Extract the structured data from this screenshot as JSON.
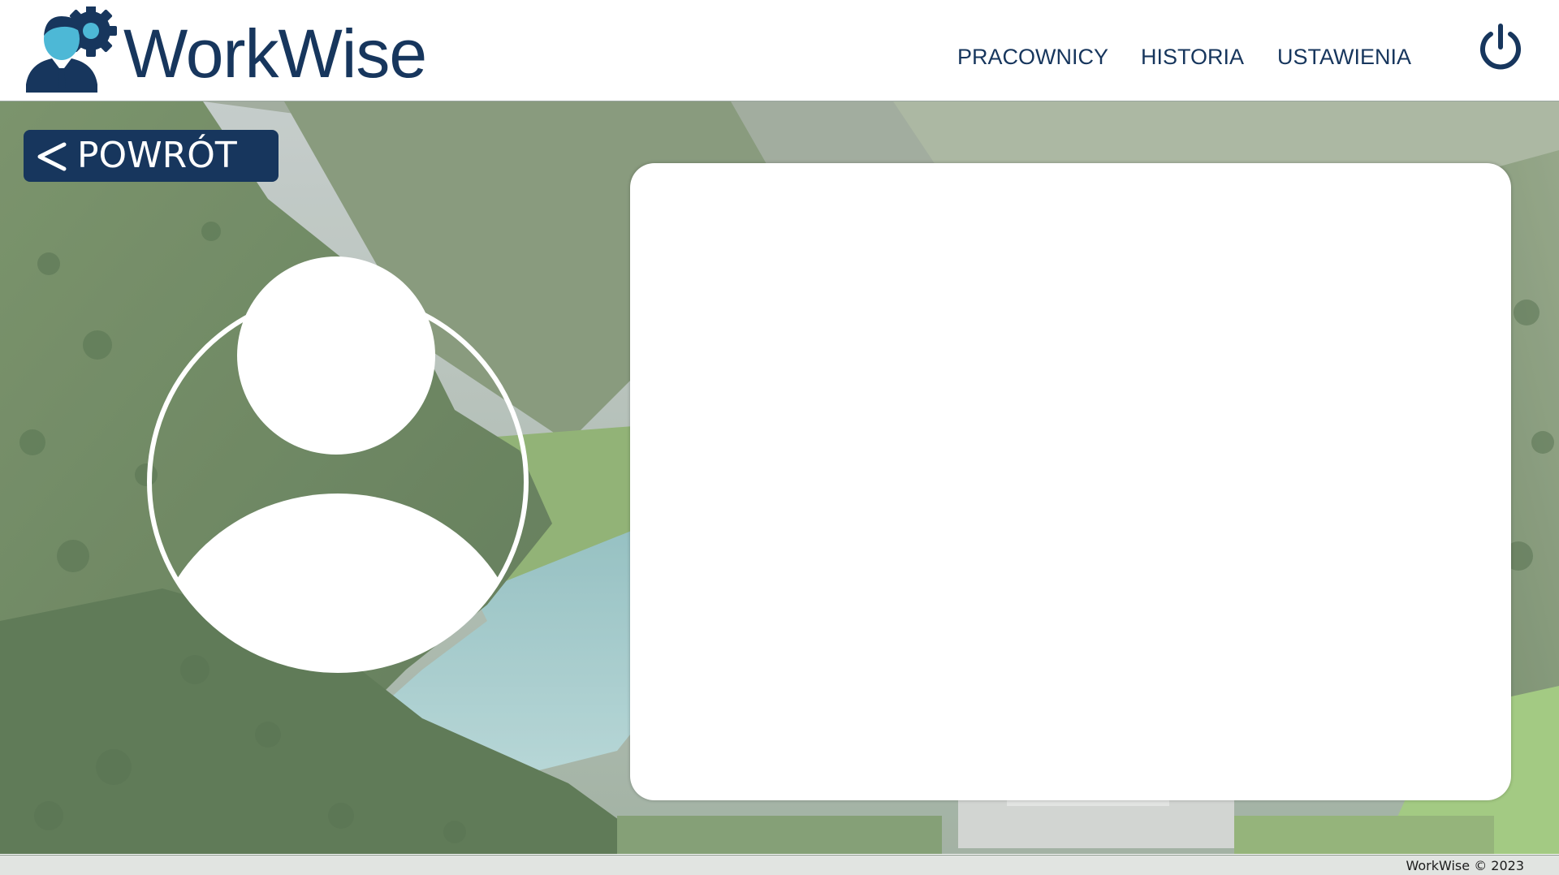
{
  "app": {
    "brand": "WorkWise",
    "colors": {
      "primary": "#17365d",
      "accent": "#4db8d6"
    }
  },
  "header": {
    "logo_icon": "person-with-gear-icon",
    "nav": [
      {
        "label": "PRACOWNICY"
      },
      {
        "label": "HISTORIA"
      },
      {
        "label": "USTAWIENIA"
      }
    ],
    "power_icon": "power-icon"
  },
  "back_button": {
    "label": "POWRÓT",
    "icon": "chevron-left-icon"
  },
  "avatar": {
    "icon": "user-placeholder-icon"
  },
  "footer": {
    "text": "WorkWise © 2023"
  }
}
